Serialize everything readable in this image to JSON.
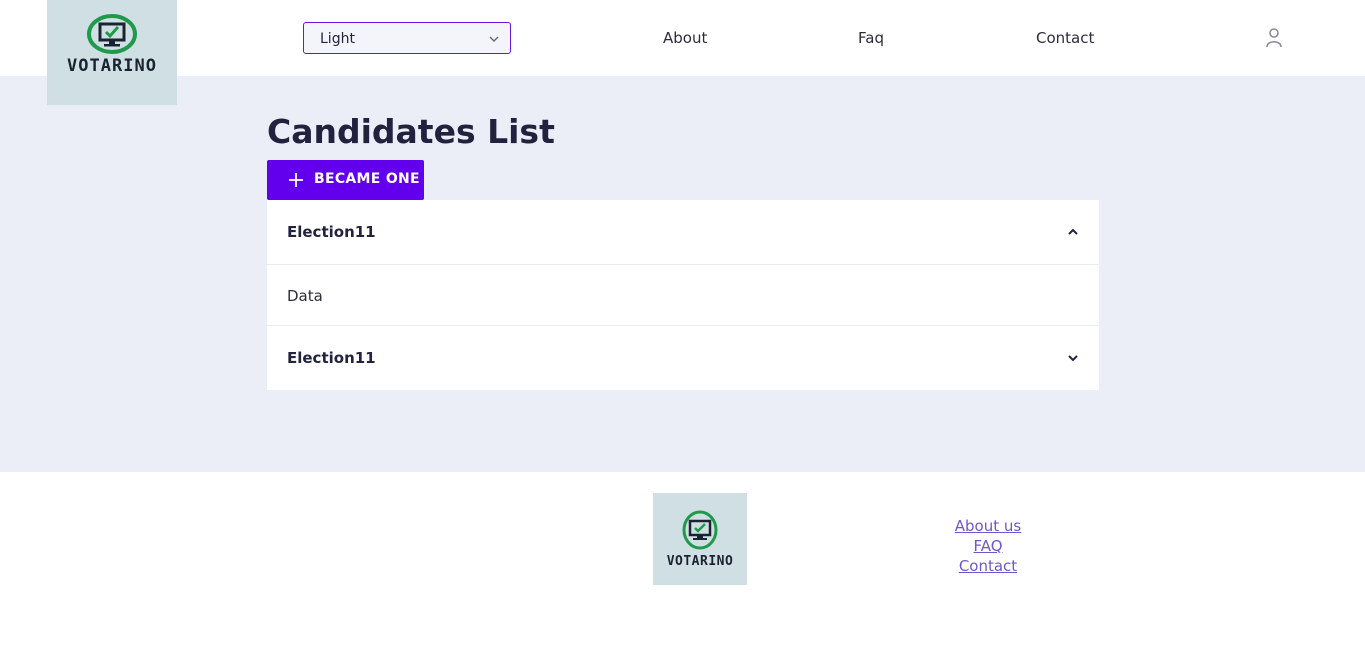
{
  "header": {
    "logo_text": "VOTARINO",
    "theme_select": {
      "value": "Light"
    },
    "nav": {
      "about": "About",
      "faq": "Faq",
      "contact": "Contact"
    }
  },
  "main": {
    "title": "Candidates List",
    "became_button": "BECAME ONE",
    "accordion": [
      {
        "title": "Election11",
        "expanded": true,
        "body": "Data"
      },
      {
        "title": "Election11",
        "expanded": false
      }
    ]
  },
  "footer": {
    "logo_text": "VOTARINO",
    "links": {
      "about": "About us",
      "faq": "FAQ",
      "contact": "Contact"
    }
  },
  "colors": {
    "accent": "#6200ee",
    "page_bg": "#ebeef7",
    "logo_bg": "#cfdfe4",
    "logo_ring": "#1f9a4b",
    "link": "#6a5acd"
  },
  "icons": [
    "ballot-monitor-icon",
    "chevron-down-icon",
    "user-icon",
    "plus-icon",
    "chevron-up-icon"
  ]
}
